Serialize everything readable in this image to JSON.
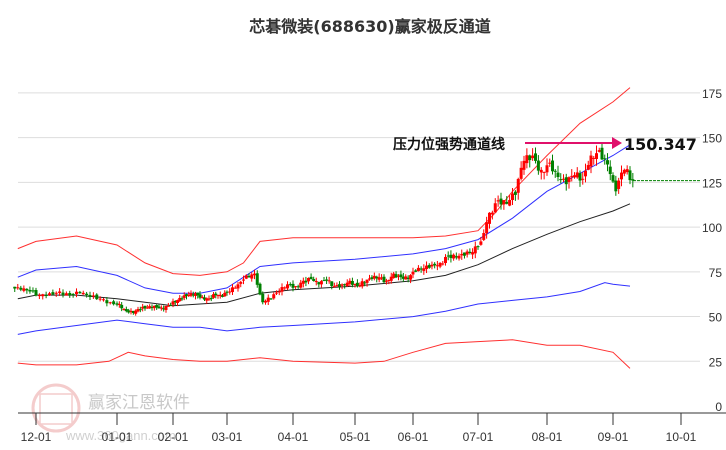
{
  "chart_data": {
    "type": "candlestick",
    "title": "芯碁微装(688630)赢家极反通道",
    "xlabel": "",
    "ylabel": "",
    "ylim": [
      0,
      180
    ],
    "y_ticks": [
      0,
      25,
      50,
      75,
      100,
      125,
      150,
      175
    ],
    "x_ticks": [
      "12-01",
      "01-01",
      "02-01",
      "03-01",
      "04-01",
      "05-01",
      "06-01",
      "07-01",
      "08-01",
      "09-01",
      "10-01"
    ],
    "x_unit": "months since 12-01",
    "grid": "horizontal",
    "price": {
      "start": -0.25,
      "step": 0.125,
      "close": [
        65,
        64,
        62,
        63,
        64,
        62,
        63,
        61,
        60,
        58,
        57,
        53,
        52,
        54,
        55,
        56,
        55,
        56,
        58,
        60,
        62,
        63,
        61,
        60,
        62,
        61,
        64,
        68,
        73,
        74,
        58,
        60,
        64,
        68,
        67,
        70,
        71,
        68,
        70,
        67,
        68,
        70,
        67,
        69,
        71,
        72,
        70,
        74,
        72,
        71,
        75,
        77,
        79,
        80,
        84,
        83,
        84,
        86,
        92,
        108,
        115,
        113,
        118,
        137,
        140,
        132,
        136,
        128,
        124,
        129,
        127,
        140,
        143,
        135,
        120,
        132,
        126
      ],
      "up_color": "#ff0000",
      "down_color": "#008000"
    },
    "bands": [
      {
        "name": "upper-red",
        "color": "#ff3030",
        "points": [
          [
            -0.25,
            88
          ],
          [
            0,
            92
          ],
          [
            0.5,
            95
          ],
          [
            1,
            90
          ],
          [
            1.5,
            80
          ],
          [
            2,
            74
          ],
          [
            2.5,
            73
          ],
          [
            3,
            75
          ],
          [
            3.25,
            80
          ],
          [
            3.5,
            92
          ],
          [
            4,
            94
          ],
          [
            5,
            94
          ],
          [
            6,
            94
          ],
          [
            6.5,
            95
          ],
          [
            7,
            98
          ],
          [
            7.25,
            108
          ],
          [
            7.5,
            120
          ],
          [
            8,
            140
          ],
          [
            8.5,
            158
          ],
          [
            9,
            170
          ],
          [
            9.25,
            178
          ]
        ]
      },
      {
        "name": "upper-blue",
        "color": "#3030ff",
        "points": [
          [
            -0.25,
            72
          ],
          [
            0,
            76
          ],
          [
            0.5,
            78
          ],
          [
            1,
            73
          ],
          [
            1.5,
            66
          ],
          [
            2,
            63
          ],
          [
            2.5,
            63
          ],
          [
            3,
            66
          ],
          [
            3.25,
            72
          ],
          [
            3.5,
            78
          ],
          [
            4,
            80
          ],
          [
            5,
            82
          ],
          [
            6,
            85
          ],
          [
            6.5,
            88
          ],
          [
            7,
            93
          ],
          [
            7.5,
            105
          ],
          [
            8,
            120
          ],
          [
            8.5,
            130
          ],
          [
            9,
            140
          ],
          [
            9.25,
            146
          ]
        ]
      },
      {
        "name": "middle-black",
        "color": "#222222",
        "points": [
          [
            -0.25,
            60
          ],
          [
            0,
            62
          ],
          [
            0.5,
            62
          ],
          [
            1,
            60
          ],
          [
            1.5,
            58
          ],
          [
            2,
            56
          ],
          [
            2.5,
            57
          ],
          [
            3,
            58
          ],
          [
            3.5,
            63
          ],
          [
            4,
            65
          ],
          [
            5,
            67
          ],
          [
            6,
            70
          ],
          [
            6.5,
            73
          ],
          [
            7,
            79
          ],
          [
            7.5,
            88
          ],
          [
            8,
            96
          ],
          [
            8.5,
            103
          ],
          [
            9,
            109
          ],
          [
            9.25,
            113
          ]
        ]
      },
      {
        "name": "lower-blue",
        "color": "#3030ff",
        "points": [
          [
            -0.25,
            40
          ],
          [
            0,
            42
          ],
          [
            0.5,
            45
          ],
          [
            1,
            48
          ],
          [
            1.5,
            46
          ],
          [
            2,
            44
          ],
          [
            2.5,
            44
          ],
          [
            3,
            42
          ],
          [
            3.5,
            44
          ],
          [
            4,
            45
          ],
          [
            5,
            47
          ],
          [
            6,
            50
          ],
          [
            6.5,
            53
          ],
          [
            7,
            57
          ],
          [
            7.5,
            59
          ],
          [
            8,
            61
          ],
          [
            8.5,
            64
          ],
          [
            8.875,
            69
          ],
          [
            9,
            68
          ],
          [
            9.25,
            67
          ]
        ]
      },
      {
        "name": "lower-red",
        "color": "#ff3030",
        "points": [
          [
            -0.25,
            24
          ],
          [
            0,
            23
          ],
          [
            0.5,
            23
          ],
          [
            0.9,
            25
          ],
          [
            1.2,
            30
          ],
          [
            1.5,
            28
          ],
          [
            2,
            26
          ],
          [
            2.5,
            25
          ],
          [
            3,
            25
          ],
          [
            3.5,
            27
          ],
          [
            4,
            25
          ],
          [
            5,
            24
          ],
          [
            5.5,
            25
          ],
          [
            6,
            30
          ],
          [
            6.5,
            35
          ],
          [
            7,
            36
          ],
          [
            7.5,
            37
          ],
          [
            8,
            34
          ],
          [
            8.5,
            34
          ],
          [
            9,
            30
          ],
          [
            9.25,
            21
          ]
        ]
      }
    ],
    "last_close_line": 126,
    "annotation": {
      "label": "压力位强势通道线",
      "value": "150.347"
    }
  },
  "watermark": {
    "name": "赢家江恩软件",
    "url": "www.360gann.com",
    "seal": [
      "江",
      "赢",
      "恩",
      "家"
    ]
  },
  "colors": {
    "up": "#ff0000",
    "down": "#008000",
    "arrow": "#e0106a",
    "grid": "#dddddd"
  }
}
